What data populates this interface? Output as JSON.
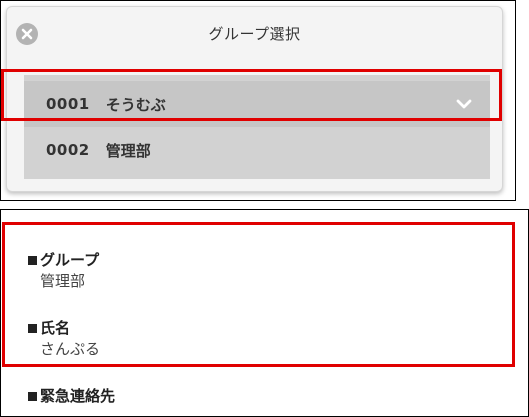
{
  "modal": {
    "title": "グループ選択",
    "close_icon": "close-circle-icon",
    "options": [
      {
        "code": "0001",
        "name": "そうむぶ",
        "selected": true,
        "icon": "chevron-down-icon"
      },
      {
        "code": "0002",
        "name": "管理部",
        "selected": false
      }
    ]
  },
  "profile": {
    "group": {
      "label": "グループ",
      "value": "管理部"
    },
    "name": {
      "label": "氏名",
      "value": "さんぷる"
    },
    "emergency": {
      "label": "緊急連絡先"
    }
  },
  "colors": {
    "highlight": "#e00000",
    "modal_background": "#f4f4f4",
    "option_background": "#d2d2d2",
    "selected_option_background": "#c6c6c6",
    "close_button": "#b3b3b3"
  }
}
